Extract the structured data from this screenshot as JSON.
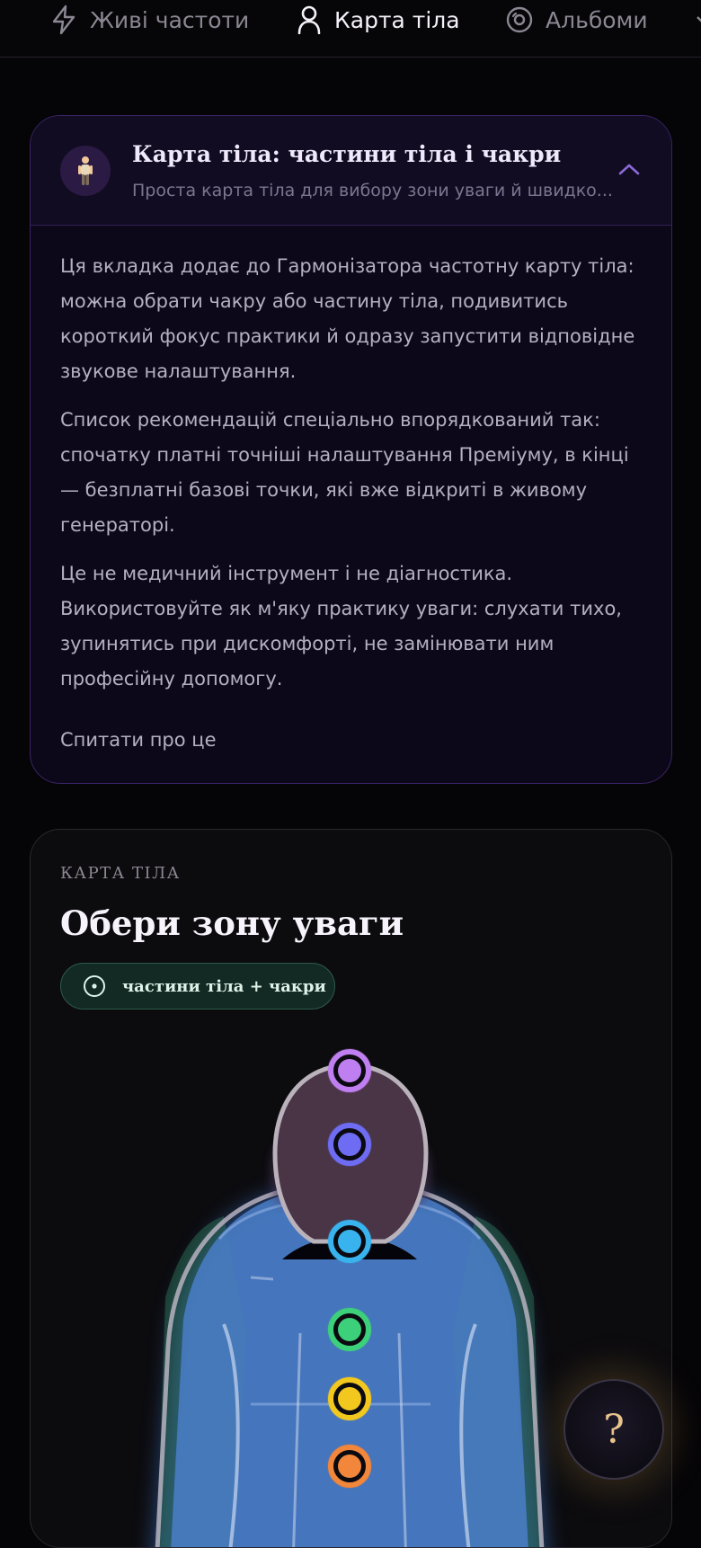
{
  "tabs": [
    {
      "label": "Живі частоти",
      "icon": "bolt-icon",
      "active": false
    },
    {
      "label": "Карта тіла",
      "icon": "person-icon",
      "active": true
    },
    {
      "label": "Альбоми",
      "icon": "disc-icon",
      "active": false
    }
  ],
  "info_card": {
    "title": "Карта тіла: частини тіла і чакри",
    "subtitle": "Проста карта тіла для вибору зони уваги й швидко...",
    "avatar": "🧍",
    "expanded": true,
    "paragraphs": [
      "Ця вкладка додає до Гармонізатора частотну карту тіла: можна обрати чакру або частину тіла, подивитись короткий фокус практики й одразу запустити відповідне звукове налаштування.",
      "Список рекомендацій спеціально впорядкований так: спочатку платні точніші налаштування Преміуму, в кінці — безплатні базові точки, які вже відкриті в живому генераторі.",
      "Це не медичний інструмент і не діагностика. Використовуйте як м'яку практику уваги: слухати тихо, зупинятись при дискомфорті, не замінювати ним професійну допомогу."
    ],
    "ask_link": "Спитати про це"
  },
  "map_card": {
    "eyebrow": "КАРТА ТІЛА",
    "title": "Обери зону уваги",
    "mode_chip": "частини тіла + чакри",
    "chakras": [
      {
        "name": "crown",
        "color": "#c07ff0"
      },
      {
        "name": "third-eye",
        "color": "#6d6cf2"
      },
      {
        "name": "throat",
        "color": "#39b3ee"
      },
      {
        "name": "heart",
        "color": "#3dd07a"
      },
      {
        "name": "solar-plexus",
        "color": "#f2c81f"
      },
      {
        "name": "sacral",
        "color": "#f2863a"
      }
    ]
  },
  "help_button": {
    "label": "?"
  },
  "colors": {
    "background": "#050407",
    "info_card_border": "#3a2466",
    "chip_green": "#122a23",
    "accent_gold": "#e8c48c"
  }
}
